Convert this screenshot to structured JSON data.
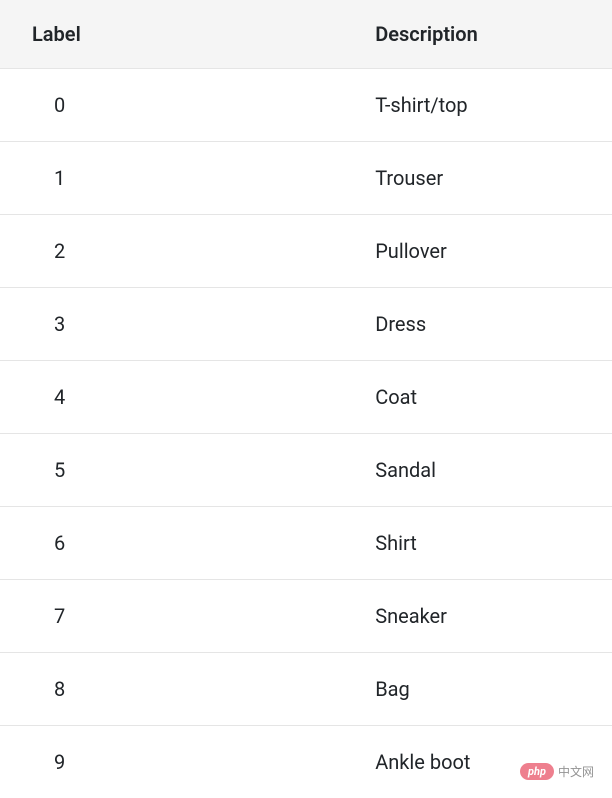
{
  "table": {
    "headers": {
      "label": "Label",
      "description": "Description"
    },
    "rows": [
      {
        "label": "0",
        "description": "T-shirt/top"
      },
      {
        "label": "1",
        "description": "Trouser"
      },
      {
        "label": "2",
        "description": "Pullover"
      },
      {
        "label": "3",
        "description": "Dress"
      },
      {
        "label": "4",
        "description": "Coat"
      },
      {
        "label": "5",
        "description": "Sandal"
      },
      {
        "label": "6",
        "description": "Shirt"
      },
      {
        "label": "7",
        "description": "Sneaker"
      },
      {
        "label": "8",
        "description": "Bag"
      },
      {
        "label": "9",
        "description": "Ankle boot"
      }
    ]
  },
  "watermark": {
    "badge": "php",
    "text": "中文网"
  }
}
